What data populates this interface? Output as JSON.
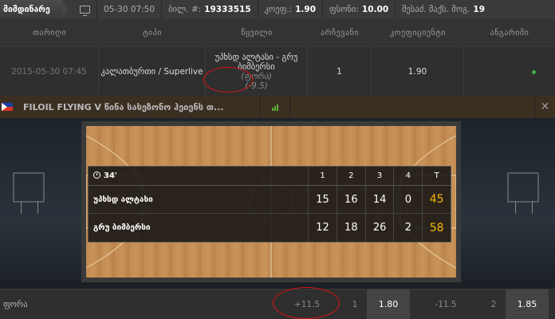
{
  "topbar": {
    "active_tab": "მიმდინარე",
    "timestamp": "05-30 07:50",
    "ticket_label": "ბილ. #:",
    "ticket_number": "19333515",
    "coef_label": "კოეფ.:",
    "coef_value": "1.90",
    "money_label": "ფსონი:",
    "money_value": "10.00",
    "max_win_label": "შესაძ. მაქს. მოგ.",
    "max_win_value": "19"
  },
  "table": {
    "headers": [
      "თარიღი",
      "ტიპი",
      "წყვილი",
      "არჩევანი",
      "კოეფიციენტი",
      "ანგარიში"
    ],
    "row": {
      "date": "2015-05-30 07:45",
      "type": "კალათბურთი / Superlive",
      "event": "უპხსდ ალტასი - გრუ ბიმბერსი",
      "handicap_label": "(ფორა)",
      "handicap_value": "(-9.5)",
      "choice": "1",
      "coefficient": "1.90",
      "status_color": "#3cb043"
    }
  },
  "banner": {
    "title": "FILOIL FLYING V წინა სასეზონო ჰეიენს თ..."
  },
  "scoreboard": {
    "clock": "34'",
    "periods": [
      "1",
      "2",
      "3",
      "4",
      "T"
    ],
    "teams": [
      {
        "name": "უპხსდ ალტასი",
        "scores": [
          "15",
          "16",
          "14",
          "0"
        ],
        "total": "45"
      },
      {
        "name": "გრუ ბიმბერსი",
        "scores": [
          "12",
          "18",
          "26",
          "2"
        ],
        "total": "58"
      }
    ]
  },
  "bet_row": {
    "label": "ფორა",
    "line1": "+11.5",
    "idx1": "1",
    "odd1": "1.80",
    "line2": "-11.5",
    "idx2": "2",
    "odd2": "1.85"
  }
}
